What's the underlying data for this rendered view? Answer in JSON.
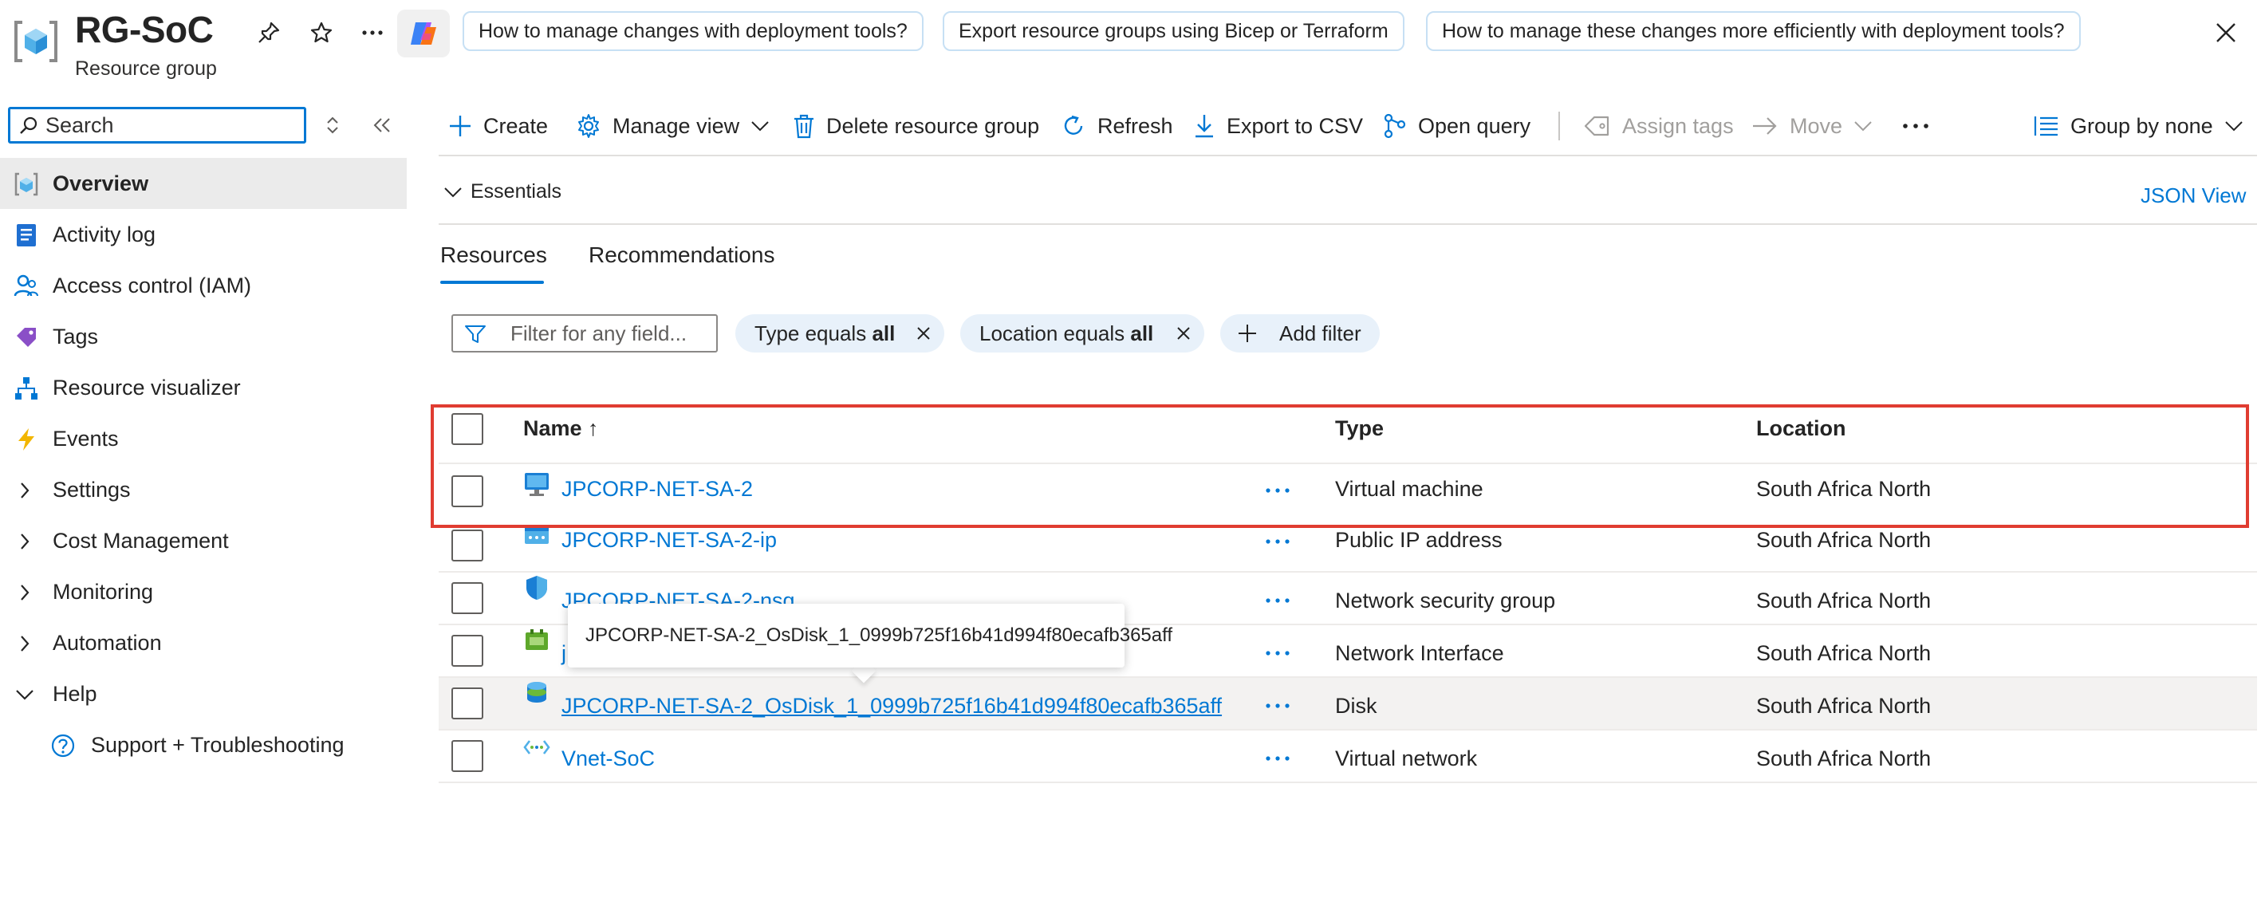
{
  "header": {
    "title": "RG-SoC",
    "subtitle": "Resource group",
    "suggestions": [
      "How to manage changes with deployment tools?",
      "Export resource groups using Bicep or Terraform",
      "How to manage these changes more efficiently with deployment tools?"
    ]
  },
  "sidebar": {
    "search_placeholder": "Search",
    "items": [
      {
        "label": "Overview",
        "icon": "resource-group-icon"
      },
      {
        "label": "Activity log",
        "icon": "activity-log-icon"
      },
      {
        "label": "Access control (IAM)",
        "icon": "iam-icon"
      },
      {
        "label": "Tags",
        "icon": "tag-icon"
      },
      {
        "label": "Resource visualizer",
        "icon": "visualizer-icon"
      },
      {
        "label": "Events",
        "icon": "events-icon"
      },
      {
        "label": "Settings",
        "icon": "chevron-right-icon"
      },
      {
        "label": "Cost Management",
        "icon": "chevron-right-icon"
      },
      {
        "label": "Monitoring",
        "icon": "chevron-right-icon"
      },
      {
        "label": "Automation",
        "icon": "chevron-right-icon"
      },
      {
        "label": "Help",
        "icon": "chevron-down-icon"
      },
      {
        "label": "Support + Troubleshooting",
        "icon": "help-circle-icon"
      }
    ]
  },
  "toolbar": {
    "create": "Create",
    "manage_view": "Manage view",
    "delete_rg": "Delete resource group",
    "refresh": "Refresh",
    "export_csv": "Export to CSV",
    "open_query": "Open query",
    "assign_tags": "Assign tags",
    "move": "Move",
    "group_by": "Group by none"
  },
  "essentials": {
    "label": "Essentials",
    "json_view": "JSON View"
  },
  "tabs": [
    "Resources",
    "Recommendations"
  ],
  "filters": {
    "placeholder": "Filter for any field...",
    "type_pill": {
      "prefix": "Type equals ",
      "value": "all"
    },
    "location_pill": {
      "prefix": "Location equals ",
      "value": "all"
    },
    "add_filter": "Add filter"
  },
  "table": {
    "columns": {
      "name": "Name ↑",
      "type": "Type",
      "location": "Location"
    },
    "rows": [
      {
        "name": "JPCORP-NET-SA-2",
        "type": "Virtual machine",
        "location": "South Africa North",
        "icon": "virtual-machine-icon"
      },
      {
        "name": "JPCORP-NET-SA-2-ip",
        "type": "Public IP address",
        "location": "South Africa North",
        "icon": "public-ip-icon"
      },
      {
        "name": "JPCORP-NET-SA-2-nsg",
        "type": "Network security group",
        "location": "South Africa North",
        "icon": "nsg-shield-icon"
      },
      {
        "name": "j",
        "type": "Network Interface",
        "location": "South Africa North",
        "icon": "network-interface-icon"
      },
      {
        "name": "JPCORP-NET-SA-2_OsDisk_1_0999b725f16b41d994f80ecafb365aff",
        "type": "Disk",
        "location": "South Africa North",
        "icon": "disk-icon"
      },
      {
        "name": "Vnet-SoC",
        "type": "Virtual network",
        "location": "South Africa North",
        "icon": "vnet-icon"
      }
    ]
  },
  "tooltip": "JPCORP-NET-SA-2_OsDisk_1_0999b725f16b41d994f80ecafb365aff",
  "colors": {
    "accent": "#0078d4",
    "highlight_box": "#e03c31",
    "pill_bg": "#e8f1fa",
    "hover_row": "#f3f2f1"
  }
}
